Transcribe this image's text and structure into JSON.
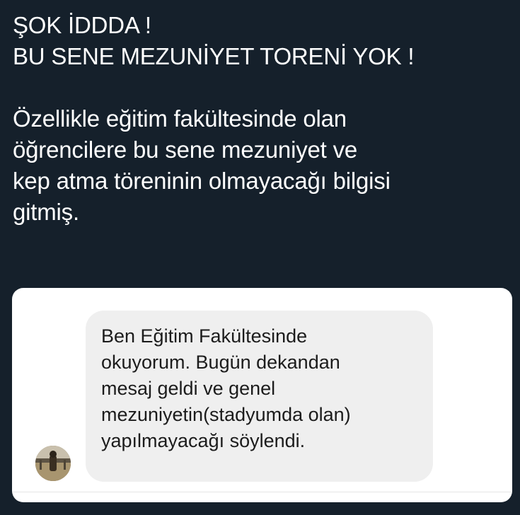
{
  "tweet": {
    "lines": [
      "ŞOK İDDDA !",
      "BU SENE MEZUNİYET TORENİ YOK !",
      "",
      "Özellikle eğitim fakültesinde olan",
      "öğrencilere bu sene mezuniyet ve",
      "kep atma töreninin olmayacağı bilgisi",
      "gitmiş."
    ]
  },
  "media": {
    "message": {
      "lines": [
        "Ben Eğitim Fakültesinde",
        "okuyorum. Bugün dekandan",
        "mesaj geldi ve genel",
        "mezuniyetin(stadyumda olan)",
        "yapılmayacağı söylendi."
      ]
    }
  },
  "colors": {
    "background": "#15202b",
    "text": "#ffffff",
    "card": "#ffffff",
    "bubble": "#efefef",
    "bubble_text": "#1c1c1c"
  }
}
